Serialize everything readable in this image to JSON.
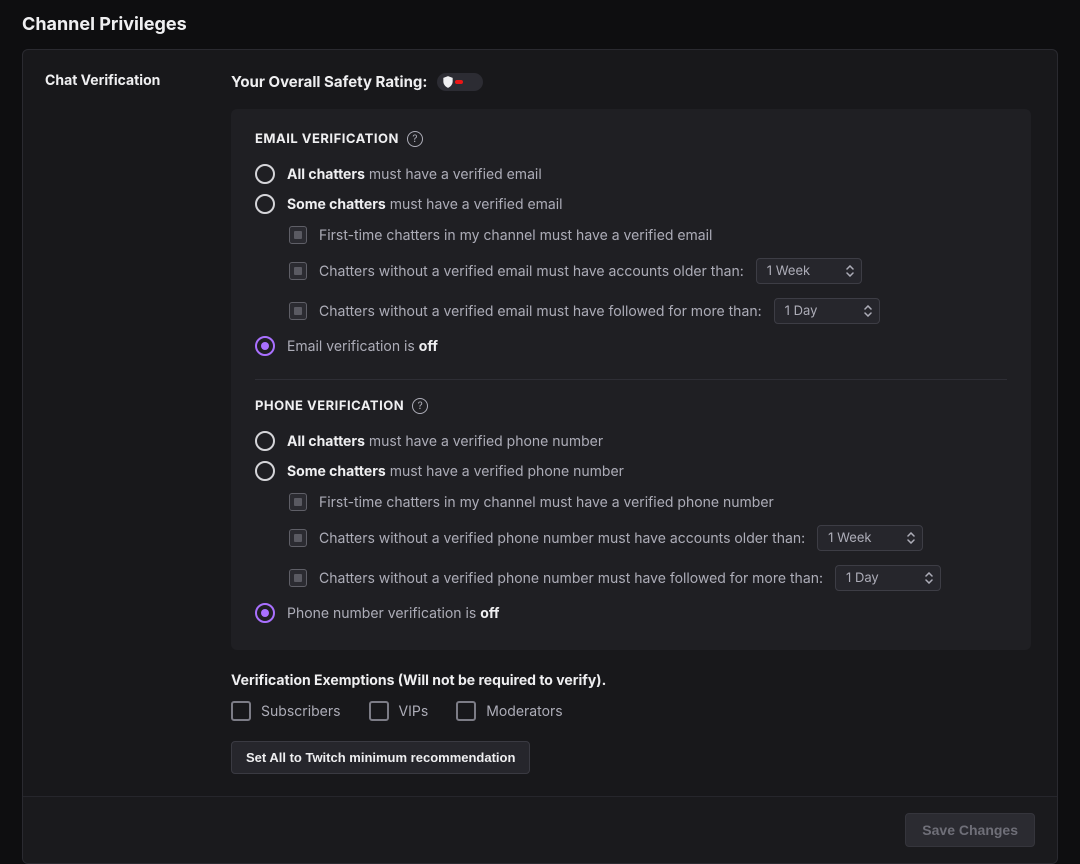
{
  "page_title": "Channel Privileges",
  "left_label": "Chat Verification",
  "rating_label": "Your Overall Safety Rating:",
  "email": {
    "title": "EMAIL VERIFICATION",
    "opt_all_bold": "All chatters",
    "opt_all_rest": " must have a verified email",
    "opt_some_bold": "Some chatters",
    "opt_some_rest": " must have a verified email",
    "sub_first": "First-time chatters in my channel must have a verified email",
    "sub_age": "Chatters without a verified email must have accounts older than:",
    "sub_age_val": "1 Week",
    "sub_follow": "Chatters without a verified email must have followed for more than:",
    "sub_follow_val": "1 Day",
    "off_pre": "Email verification is ",
    "off_bold": "off"
  },
  "phone": {
    "title": "PHONE VERIFICATION",
    "opt_all_bold": "All chatters",
    "opt_all_rest": " must have a verified phone number",
    "opt_some_bold": "Some chatters",
    "opt_some_rest": " must have a verified phone number",
    "sub_first": "First-time chatters in my channel must have a verified phone number",
    "sub_age": "Chatters without a verified phone number must have accounts older than:",
    "sub_age_val": "1 Week",
    "sub_follow": "Chatters without a verified phone number must have followed for more than:",
    "sub_follow_val": "1 Day",
    "off_pre": "Phone number verification is ",
    "off_bold": "off"
  },
  "exempt": {
    "title": "Verification Exemptions (Will not be required to verify).",
    "subs": "Subscribers",
    "vips": "VIPs",
    "mods": "Moderators"
  },
  "set_all_btn": "Set All to Twitch minimum recommendation",
  "save_btn": "Save Changes"
}
